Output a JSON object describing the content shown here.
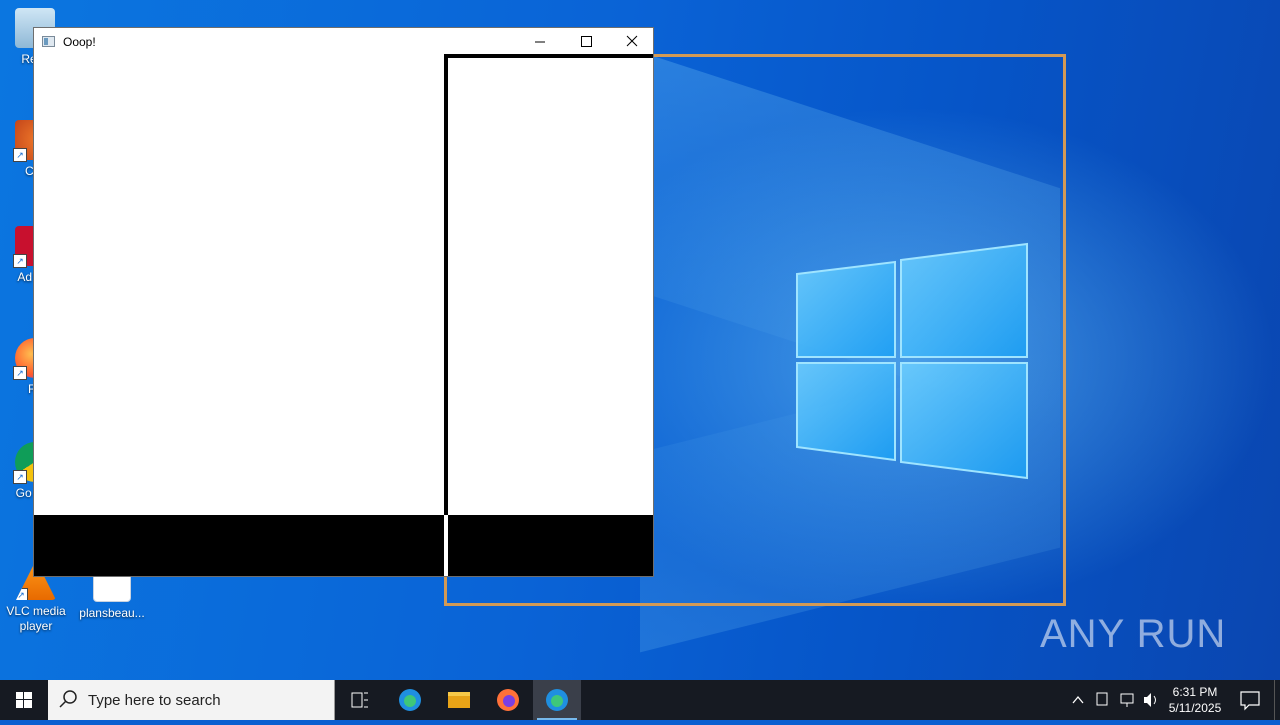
{
  "window": {
    "title": "Ooop!",
    "min_icon": "minimize-icon",
    "max_icon": "maximize-icon",
    "close_icon": "close-icon"
  },
  "desktop_icons": [
    {
      "label": "Recy",
      "icon": "recycle-bin-icon"
    },
    {
      "label": "CCl",
      "icon": "ccleaner-icon"
    },
    {
      "label": "Ad Acr",
      "icon": "adobe-acrobat-icon"
    },
    {
      "label": "Fir",
      "icon": "firefox-icon"
    },
    {
      "label": "Go Chr",
      "icon": "chrome-icon"
    },
    {
      "label": "VLC media player",
      "icon": "vlc-icon"
    },
    {
      "label": "plansbeau...",
      "icon": "document-icon"
    }
  ],
  "taskbar": {
    "search_placeholder": "Type here to search",
    "apps": [
      "task-view-icon",
      "edge-icon",
      "file-explorer-icon",
      "firefox-icon",
      "edge-icon"
    ]
  },
  "clock": {
    "time": "6:31 PM",
    "date": "5/11/2025"
  },
  "watermark": "ANY RUN",
  "colors": {
    "desktop_blue": "#0a63d6",
    "orange_frame": "#d39a55",
    "taskbar": "#161a22"
  }
}
